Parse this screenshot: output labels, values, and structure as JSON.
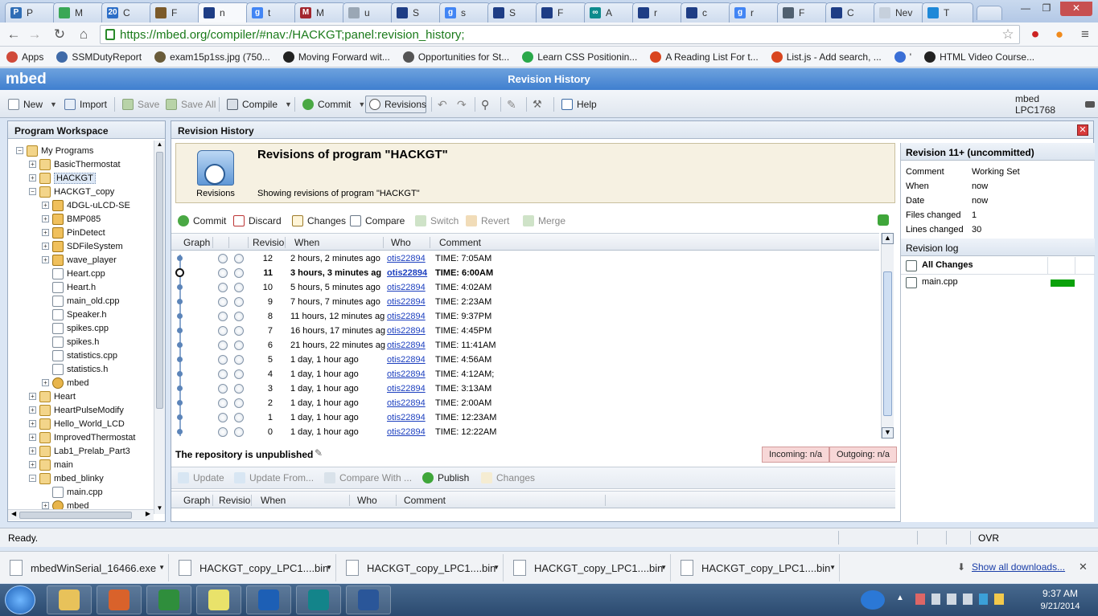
{
  "browser": {
    "tabs": [
      {
        "label": "P",
        "fav": "P",
        "color": "#2f6db5"
      },
      {
        "label": "M",
        "fav": "",
        "color": "#3aa756"
      },
      {
        "label": "C",
        "fav": "20",
        "color": "#2c6ec7"
      },
      {
        "label": "F",
        "fav": "",
        "color": "#7b5a2a"
      },
      {
        "label": "n",
        "fav": "",
        "color": "#1e3d85"
      },
      {
        "label": "t",
        "fav": "g",
        "color": "#4285f4"
      },
      {
        "label": "M",
        "fav": "M",
        "color": "#a3262e"
      },
      {
        "label": "u",
        "fav": "",
        "color": "#9aa7b5"
      },
      {
        "label": "S",
        "fav": "",
        "color": "#1e3d85"
      },
      {
        "label": "s",
        "fav": "g",
        "color": "#4285f4"
      },
      {
        "label": "S",
        "fav": "",
        "color": "#1e3d85"
      },
      {
        "label": "F",
        "fav": "",
        "color": "#1e3d85"
      },
      {
        "label": "A",
        "fav": "∞",
        "color": "#0f8b8d"
      },
      {
        "label": "r",
        "fav": "",
        "color": "#1e3d85"
      },
      {
        "label": "c",
        "fav": "",
        "color": "#1e3d85"
      },
      {
        "label": "r",
        "fav": "g",
        "color": "#4285f4"
      },
      {
        "label": "F",
        "fav": "",
        "color": "#506070"
      },
      {
        "label": "C",
        "fav": "",
        "color": "#1e3d85"
      },
      {
        "label": "Nev",
        "fav": "",
        "color": "#c6d0dc"
      },
      {
        "label": "T",
        "fav": "",
        "color": "#1e88d8"
      }
    ],
    "window_controls": {
      "minimize": "—",
      "maximize": "❐",
      "close": "✕"
    },
    "url": "https://mbed.org/compiler/#nav:/HACKGT;panel:revision_history;",
    "bookmarks": [
      {
        "label": "Apps",
        "color": "#d04a3a"
      },
      {
        "label": "SSMDutyReport",
        "color": "#3f6aa8"
      },
      {
        "label": "exam15p1ss.jpg (750...",
        "color": "#6a5c3a"
      },
      {
        "label": "Moving Forward wit...",
        "color": "#222222"
      },
      {
        "label": "Opportunities for St...",
        "color": "#555555"
      },
      {
        "label": "Learn CSS Positionin...",
        "color": "#2aa84a"
      },
      {
        "label": "A Reading List For t...",
        "color": "#d9461f"
      },
      {
        "label": "List.js - Add search, ...",
        "color": "#d9461f"
      },
      {
        "label": "'",
        "color": "#3a6fd6"
      },
      {
        "label": "HTML Video Course...",
        "color": "#222222"
      }
    ]
  },
  "mbed": {
    "logo": "mbed",
    "title": "Revision History",
    "toolbar": {
      "new": "New",
      "import": "Import",
      "save": "Save",
      "save_all": "Save All",
      "compile": "Compile",
      "commit": "Commit",
      "revisions": "Revisions",
      "help": "Help",
      "target": "mbed LPC1768"
    },
    "workspace": {
      "title": "Program Workspace",
      "nodes": [
        {
          "label": "My Programs",
          "depth": 0,
          "pm": "−",
          "icon": "f-prog"
        },
        {
          "label": "BasicThermostat",
          "depth": 1,
          "pm": "+",
          "icon": "f-prog"
        },
        {
          "label": "HACKGT",
          "depth": 1,
          "pm": "+",
          "icon": "f-prog",
          "selected": true
        },
        {
          "label": "HACKGT_copy",
          "depth": 1,
          "pm": "−",
          "icon": "f-prog"
        },
        {
          "label": "4DGL-uLCD-SE",
          "depth": 2,
          "pm": "+",
          "icon": "f-lib"
        },
        {
          "label": "BMP085",
          "depth": 2,
          "pm": "+",
          "icon": "f-lib"
        },
        {
          "label": "PinDetect",
          "depth": 2,
          "pm": "+",
          "icon": "f-lib"
        },
        {
          "label": "SDFileSystem",
          "depth": 2,
          "pm": "+",
          "icon": "f-lib"
        },
        {
          "label": "wave_player",
          "depth": 2,
          "pm": "+",
          "icon": "f-lib"
        },
        {
          "label": "Heart.cpp",
          "depth": 2,
          "pm": "",
          "icon": "f-file"
        },
        {
          "label": "Heart.h",
          "depth": 2,
          "pm": "",
          "icon": "f-file"
        },
        {
          "label": "main_old.cpp",
          "depth": 2,
          "pm": "",
          "icon": "f-file"
        },
        {
          "label": "Speaker.h",
          "depth": 2,
          "pm": "",
          "icon": "f-file"
        },
        {
          "label": "spikes.cpp",
          "depth": 2,
          "pm": "",
          "icon": "f-file"
        },
        {
          "label": "spikes.h",
          "depth": 2,
          "pm": "",
          "icon": "f-file"
        },
        {
          "label": "statistics.cpp",
          "depth": 2,
          "pm": "",
          "icon": "f-file"
        },
        {
          "label": "statistics.h",
          "depth": 2,
          "pm": "",
          "icon": "f-file"
        },
        {
          "label": "mbed",
          "depth": 2,
          "pm": "+",
          "icon": "f-gear"
        },
        {
          "label": "Heart",
          "depth": 1,
          "pm": "+",
          "icon": "f-prog"
        },
        {
          "label": "HeartPulseModify",
          "depth": 1,
          "pm": "+",
          "icon": "f-prog"
        },
        {
          "label": "Hello_World_LCD",
          "depth": 1,
          "pm": "+",
          "icon": "f-prog"
        },
        {
          "label": "ImprovedThermostat",
          "depth": 1,
          "pm": "+",
          "icon": "f-prog"
        },
        {
          "label": "Lab1_Prelab_Part3",
          "depth": 1,
          "pm": "+",
          "icon": "f-prog"
        },
        {
          "label": "main",
          "depth": 1,
          "pm": "+",
          "icon": "f-prog"
        },
        {
          "label": "mbed_blinky",
          "depth": 1,
          "pm": "−",
          "icon": "f-prog"
        },
        {
          "label": "main.cpp",
          "depth": 2,
          "pm": "",
          "icon": "f-file"
        },
        {
          "label": "mbed",
          "depth": 2,
          "pm": "+",
          "icon": "f-gear"
        }
      ]
    },
    "revision": {
      "panel_title": "Revision History",
      "banner_title": "Revisions of program \"HACKGT\"",
      "banner_caption": "Revisions",
      "banner_sub": "Showing revisions of program \"HACKGT\"",
      "actions": {
        "commit": "Commit",
        "discard": "Discard",
        "changes": "Changes",
        "compare": "Compare",
        "switch": "Switch",
        "revert": "Revert",
        "merge": "Merge"
      },
      "columns": {
        "graph": "Graph",
        "revision": "Revisio",
        "when": "When",
        "who": "Who",
        "comment": "Comment"
      },
      "rows": [
        {
          "rev": "12",
          "when": "2 hours, 2 minutes ago",
          "who": "otis22894",
          "comment": "TIME: 7:05AM"
        },
        {
          "rev": "11",
          "when": "3 hours, 3 minutes ag",
          "who": "otis22894",
          "comment": "TIME: 6:00AM",
          "current": true
        },
        {
          "rev": "10",
          "when": "5 hours, 5 minutes ago",
          "who": "otis22894",
          "comment": "TIME: 4:02AM"
        },
        {
          "rev": "9",
          "when": "7 hours, 7 minutes ago",
          "who": "otis22894",
          "comment": "TIME: 2:23AM"
        },
        {
          "rev": "8",
          "when": "11 hours, 12 minutes ag",
          "who": "otis22894",
          "comment": "TIME: 9:37PM"
        },
        {
          "rev": "7",
          "when": "16 hours, 17 minutes ag",
          "who": "otis22894",
          "comment": "TIME: 4:45PM"
        },
        {
          "rev": "6",
          "when": "21 hours, 22 minutes ag",
          "who": "otis22894",
          "comment": "TIME: 11:41AM"
        },
        {
          "rev": "5",
          "when": "1 day, 1 hour ago",
          "who": "otis22894",
          "comment": "TIME: 4:56AM"
        },
        {
          "rev": "4",
          "when": "1 day, 1 hour ago",
          "who": "otis22894",
          "comment": "TIME: 4:12AM;"
        },
        {
          "rev": "3",
          "when": "1 day, 1 hour ago",
          "who": "otis22894",
          "comment": "TIME: 3:13AM"
        },
        {
          "rev": "2",
          "when": "1 day, 1 hour ago",
          "who": "otis22894",
          "comment": "TIME: 2:00AM"
        },
        {
          "rev": "1",
          "when": "1 day, 1 hour ago",
          "who": "otis22894",
          "comment": "TIME: 12:23AM"
        },
        {
          "rev": "0",
          "when": "1 day, 1 hour ago",
          "who": "otis22894",
          "comment": "TIME: 12:22AM"
        }
      ],
      "repo_status": "The repository is unpublished",
      "incoming": "Incoming: n/a",
      "outgoing": "Outgoing: n/a",
      "pub_actions": {
        "update": "Update",
        "update_from": "Update From...",
        "compare_with": "Compare With ...",
        "publish": "Publish",
        "changes": "Changes"
      }
    },
    "detail": {
      "title": "Revision 11+ (uncommitted)",
      "fields": [
        {
          "k": "Comment",
          "v": "Working Set"
        },
        {
          "k": "When",
          "v": "now"
        },
        {
          "k": "Date",
          "v": "now"
        },
        {
          "k": "Files changed",
          "v": "1"
        },
        {
          "k": "Lines changed",
          "v": "30"
        }
      ],
      "log_title": "Revision log",
      "all_changes": "All Changes",
      "file": "main.cpp",
      "bar_color": "#0aa10a"
    },
    "status": {
      "text": "Ready.",
      "ovr": "OVR"
    }
  },
  "downloads": {
    "items": [
      "mbedWinSerial_16466.exe",
      "HACKGT_copy_LPC1....bin",
      "HACKGT_copy_LPC1....bin",
      "HACKGT_copy_LPC1....bin",
      "HACKGT_copy_LPC1....bin"
    ],
    "show_all": "Show all downloads...",
    "close": "✕"
  },
  "taskbar": {
    "apps": [
      {
        "name": "file-explorer",
        "color": "#e8c25a"
      },
      {
        "name": "matlab",
        "color": "#d9622b"
      },
      {
        "name": "chrome",
        "color": "#2f8e3c"
      },
      {
        "name": "sticky-notes",
        "color": "#e9e26a"
      },
      {
        "name": "outlook",
        "color": "#1d5fb5"
      },
      {
        "name": "arduino",
        "color": "#13848a"
      },
      {
        "name": "word",
        "color": "#2a5699"
      }
    ],
    "time": "9:37 AM",
    "date": "9/21/2014"
  }
}
